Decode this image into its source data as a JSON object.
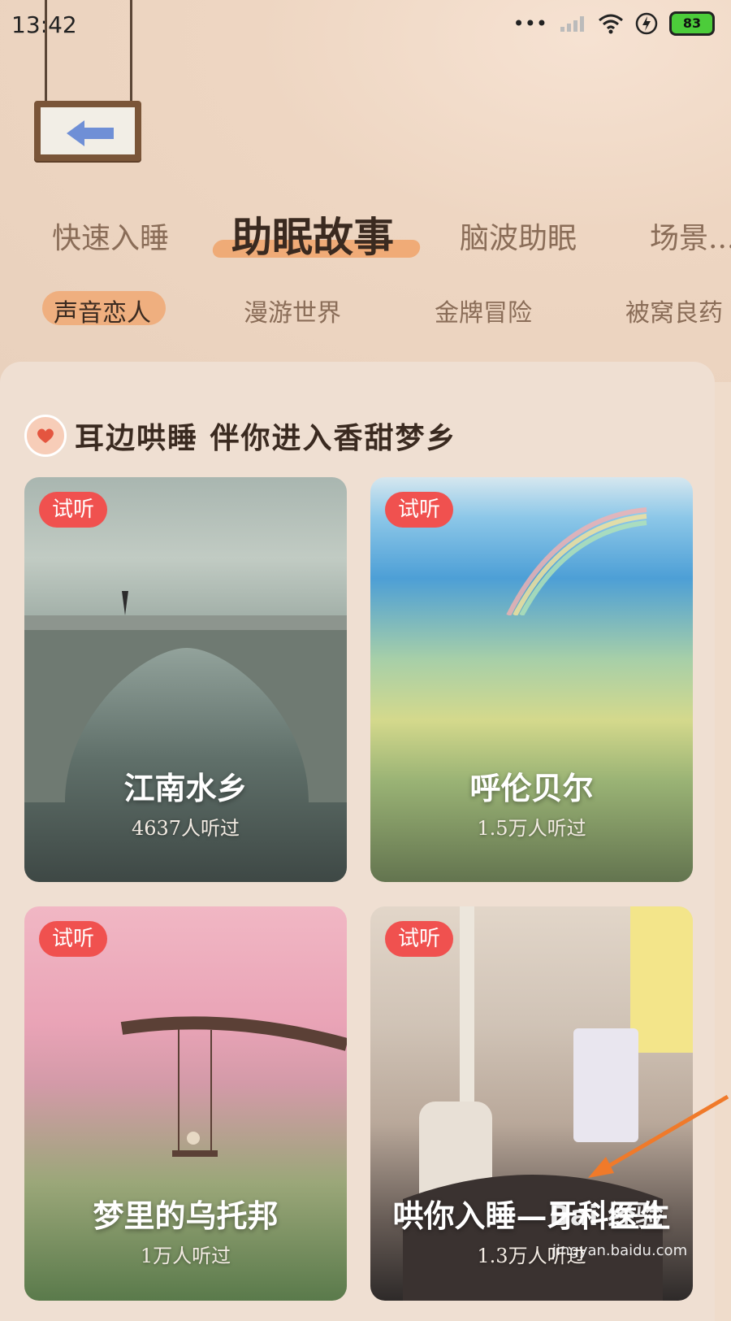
{
  "status_bar": {
    "time": "13:42",
    "battery": "83"
  },
  "main_tabs": [
    {
      "label": "快速入睡"
    },
    {
      "label": "助眠故事"
    },
    {
      "label": "脑波助眠"
    },
    {
      "label": "场景..."
    }
  ],
  "sub_tabs": [
    {
      "label": "声音恋人"
    },
    {
      "label": "漫游世界"
    },
    {
      "label": "金牌冒险"
    },
    {
      "label": "被窝良药"
    }
  ],
  "section": {
    "title": "耳边哄睡  伴你进入香甜梦乡"
  },
  "cards": [
    {
      "badge": "试听",
      "name": "江南水乡",
      "count": "4637人听过"
    },
    {
      "badge": "试听",
      "name": "呼伦贝尔",
      "count": "1.5万人听过"
    },
    {
      "badge": "试听",
      "name": "梦里的乌托邦",
      "count": "1万人听过"
    },
    {
      "badge": "试听",
      "name": "哄你入睡—牙科医生",
      "count": "1.3万人听过"
    }
  ],
  "watermark": {
    "brand": "Bai 经验",
    "url": "jingyan.baidu.com"
  },
  "colors": {
    "accent": "#f0a36a",
    "badge": "#f0514f",
    "text_dark": "#3a2a20",
    "text_muted": "#8a6d58"
  }
}
